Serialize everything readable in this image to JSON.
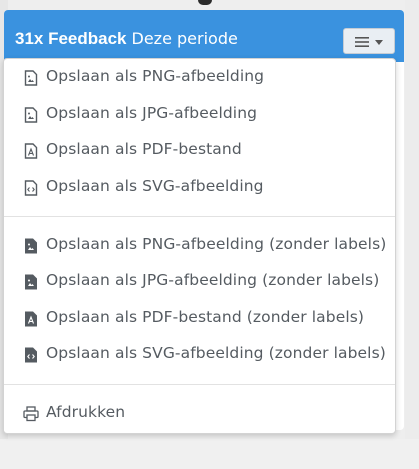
{
  "header": {
    "title": "31x Feedback",
    "subtitle": "Deze periode",
    "background_color": "#3a92df"
  },
  "menu_button": {
    "icon": "hamburger-icon",
    "caret": "caret-down-icon"
  },
  "dropdown": {
    "items": [
      {
        "label": "Opslaan als PNG-afbeelding",
        "icon": "file-image-icon"
      },
      {
        "label": "Opslaan als JPG-afbeelding",
        "icon": "file-image-icon"
      },
      {
        "label": "Opslaan als PDF-bestand",
        "icon": "file-pdf-icon"
      },
      {
        "label": "Opslaan als SVG-afbeelding",
        "icon": "file-code-icon"
      },
      {
        "label": "Opslaan als PNG-afbeelding (zonder labels)",
        "icon": "file-image-solid-icon"
      },
      {
        "label": "Opslaan als JPG-afbeelding (zonder labels)",
        "icon": "file-image-solid-icon"
      },
      {
        "label": "Opslaan als PDF-bestand (zonder labels)",
        "icon": "file-pdf-solid-icon"
      },
      {
        "label": "Opslaan als SVG-afbeelding (zonder labels)",
        "icon": "file-code-solid-icon"
      },
      {
        "label": "Afdrukken",
        "icon": "print-icon"
      }
    ]
  }
}
